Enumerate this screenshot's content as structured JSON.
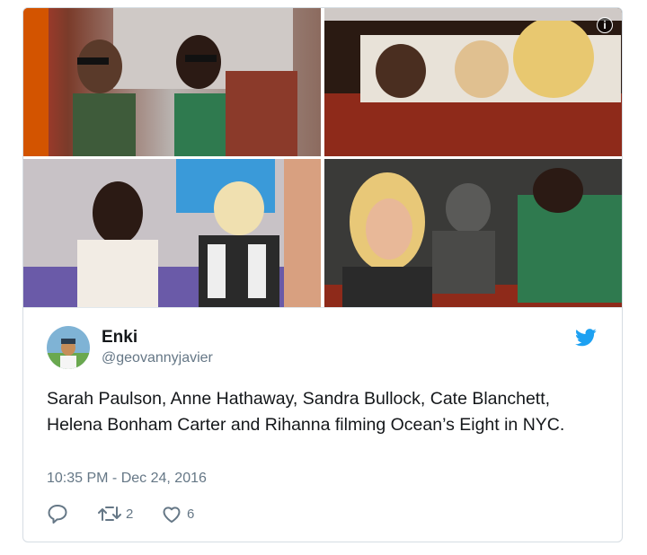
{
  "tweet": {
    "display_name": "Enki",
    "handle": "@geovannyjavier",
    "text": "Sarah Paulson, Anne Hathaway, Sandra Bullock, Cate Blanchett, Helena Bonham Carter and Rihanna filming Ocean’s Eight in NYC.",
    "timestamp": "10:35 PM - Dec 24, 2016",
    "retweet_count": "2",
    "like_count": "6"
  },
  "media": {
    "info_glyph": "i",
    "photo_count": 4
  },
  "icons": [
    "info-icon",
    "twitter-bird-icon",
    "reply-icon",
    "retweet-icon",
    "like-icon"
  ],
  "colors": {
    "twitter_blue": "#1da1f2",
    "text_primary": "#14171a",
    "text_secondary": "#657786",
    "border": "#d6dde3"
  }
}
